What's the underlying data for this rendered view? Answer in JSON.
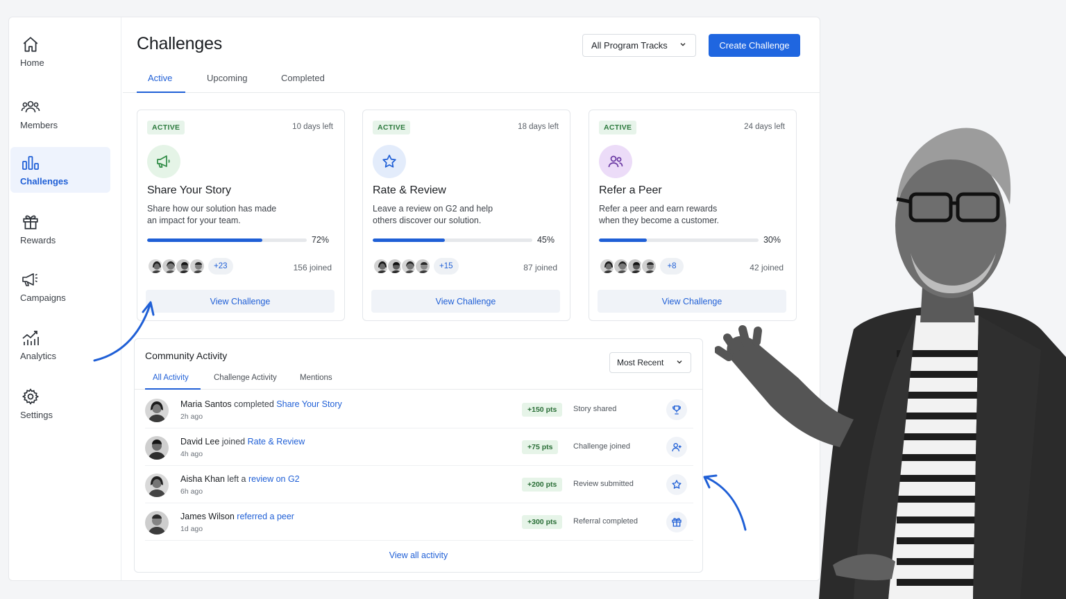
{
  "sidebar": {
    "items": [
      {
        "label": "Home",
        "icon": "home-icon"
      },
      {
        "label": "Members",
        "icon": "members-icon"
      },
      {
        "label": "Challenges",
        "icon": "bar-chart-icon"
      },
      {
        "label": "Rewards",
        "icon": "gift-icon"
      },
      {
        "label": "Campaigns",
        "icon": "megaphone-icon"
      },
      {
        "label": "Analytics",
        "icon": "analytics-icon"
      },
      {
        "label": "Settings",
        "icon": "gear-icon"
      }
    ],
    "active": "Challenges"
  },
  "header": {
    "title": "Challenges",
    "track_filter": "All Program Tracks",
    "create_label": "Create Challenge"
  },
  "tabs": [
    "Active",
    "Upcoming",
    "Completed"
  ],
  "active_tab": "Active",
  "cards": [
    {
      "status": "ACTIVE",
      "days_left": "10 days left",
      "icon": "megaphone-icon",
      "title": "Share Your Story",
      "desc": "Share how our solution has made an impact for your team.",
      "progress": 72,
      "progress_label": "72%",
      "more": "+23",
      "joined": "156 joined",
      "cta": "View Challenge"
    },
    {
      "status": "ACTIVE",
      "days_left": "18 days left",
      "icon": "star-icon",
      "title": "Rate & Review",
      "desc": "Leave a review on G2 and help others discover our solution.",
      "progress": 45,
      "progress_label": "45%",
      "more": "+15",
      "joined": "87 joined",
      "cta": "View Challenge"
    },
    {
      "status": "ACTIVE",
      "days_left": "24 days left",
      "icon": "users-icon",
      "title": "Refer a Peer",
      "desc": "Refer a peer and earn rewards when they become a customer.",
      "progress": 30,
      "progress_label": "30%",
      "more": "+8",
      "joined": "42 joined",
      "cta": "View Challenge"
    }
  ],
  "activity": {
    "title": "Community Activity",
    "sort": "Most Recent",
    "tabs": [
      "All Activity",
      "Challenge Activity",
      "Mentions"
    ],
    "rows": [
      {
        "name": "Maria Santos",
        "verb": " completed ",
        "link": "Share Your Story",
        "time": "2h ago",
        "points": "+150 pts",
        "status": "Story shared",
        "icon": "trophy-icon"
      },
      {
        "name": "David Lee",
        "verb": " joined ",
        "link": "Rate & Review",
        "time": "4h ago",
        "points": "+75 pts",
        "status": "Challenge joined",
        "icon": "user-plus-icon"
      },
      {
        "name": "Aisha Khan",
        "verb": " left a ",
        "link": "review on G2",
        "time": "6h ago",
        "points": "+200 pts",
        "status": "Review submitted",
        "icon": "star-icon"
      },
      {
        "name": "James Wilson",
        "verb": " ",
        "link": "referred a peer",
        "time": "1d ago",
        "points": "+300 pts",
        "status": "Referral completed",
        "icon": "gift-icon"
      }
    ],
    "view_all": "View all activity"
  },
  "colors": {
    "accent": "#1f66e0",
    "active_badge_bg": "#e7f4ea",
    "points_bg": "#e6f4e8"
  }
}
